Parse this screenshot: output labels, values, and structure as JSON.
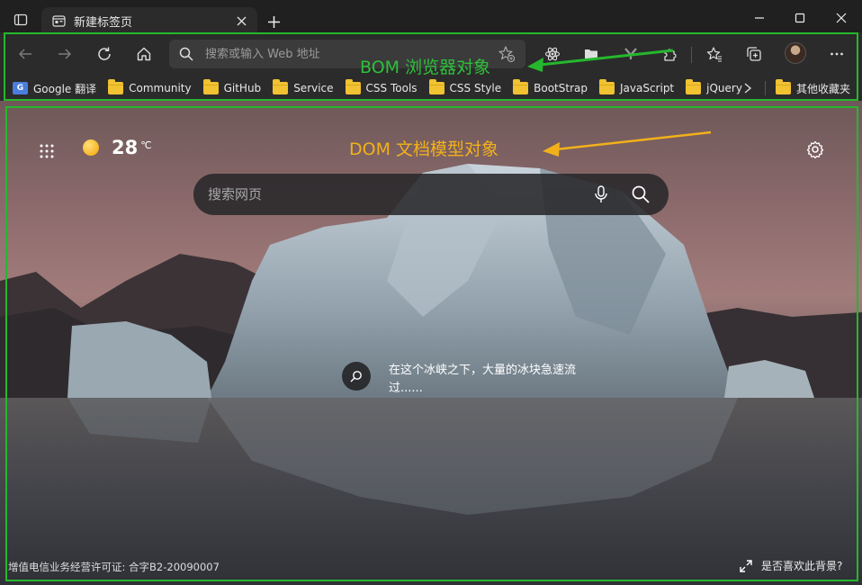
{
  "tab": {
    "title": "新建标签页"
  },
  "address_bar": {
    "placeholder": "搜索或输入 Web 地址",
    "value": ""
  },
  "bookmarks": [
    {
      "label": "Google 翻译",
      "icon": "google-translate-icon"
    },
    {
      "label": "Community",
      "icon": "folder-icon"
    },
    {
      "label": "GitHub",
      "icon": "folder-icon"
    },
    {
      "label": "Service",
      "icon": "folder-icon"
    },
    {
      "label": "CSS Tools",
      "icon": "folder-icon"
    },
    {
      "label": "CSS Style",
      "icon": "folder-icon"
    },
    {
      "label": "BootStrap",
      "icon": "folder-icon"
    },
    {
      "label": "JavaScript",
      "icon": "folder-icon"
    },
    {
      "label": "jQuery",
      "icon": "folder-icon"
    }
  ],
  "other_bookmarks": {
    "label": "其他收藏夹",
    "icon": "folder-icon"
  },
  "weather": {
    "temperature": "28",
    "unit": "℃"
  },
  "page_search": {
    "placeholder": "搜索网页",
    "value": ""
  },
  "background_caption": "在这个冰峡之下，大量的冰块急速流过......",
  "footer": {
    "license": "增值电信业务经营许可证: 合字B2-20090007",
    "like_background": "是否喜欢此背景?"
  },
  "annotations": {
    "bom": "BOM 浏览器对象",
    "dom": "DOM 文档模型对象",
    "bom_color": "#25b72d",
    "dom_color": "#f2b11a"
  },
  "colors": {
    "chrome_bg": "#202020",
    "toolbar_bg": "#2b2b2b",
    "folder": "#f1c231"
  }
}
